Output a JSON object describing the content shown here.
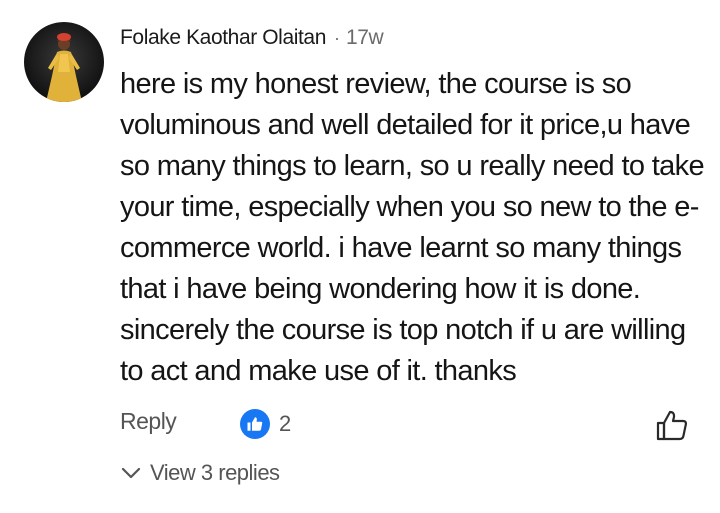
{
  "comment": {
    "author": "Folake Kaothar Olaitan",
    "separator": "·",
    "time": "17w",
    "text": "here is my honest review, the course is so voluminous and well detailed for it price,u have so many things to learn, so u really need to take your time, especially when you so new to the e-commerce world. i have learnt so many things that i have being wondering how it is done. sincerely the course is top notch if u are willing to act and make use of it. thanks"
  },
  "actions": {
    "reply_label": "Reply",
    "like_count": "2",
    "like_icon": "thumbs-up-outline-icon",
    "reaction_icon": "thumbs-up-badge-icon"
  },
  "replies": {
    "label": "View 3 replies",
    "icon": "chevron-down-icon"
  },
  "colors": {
    "accent": "#1877f2",
    "text": "#151515",
    "muted": "#555555",
    "background": "#ffffff"
  }
}
